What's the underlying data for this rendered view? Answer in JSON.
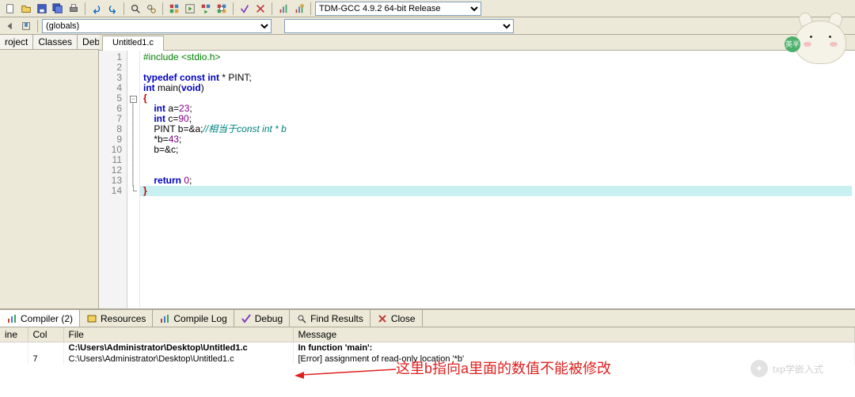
{
  "toolbar": {
    "compiler_option": "TDM-GCC 4.9.2 64-bit Release"
  },
  "toolbar2": {
    "globals_option": "(globals)"
  },
  "left_panel": {
    "tabs": [
      "roject",
      "Classes",
      "Debug"
    ]
  },
  "editor": {
    "tab_name": "Untitled1.c",
    "lines": {
      "l1": {
        "num": "1"
      },
      "l2": {
        "num": "2"
      },
      "l3": {
        "num": "3"
      },
      "l4": {
        "num": "4"
      },
      "l5": {
        "num": "5"
      },
      "l6": {
        "num": "6"
      },
      "l7": {
        "num": "7"
      },
      "l8": {
        "num": "8"
      },
      "l9": {
        "num": "9"
      },
      "l10": {
        "num": "10"
      },
      "l11": {
        "num": "11"
      },
      "l12": {
        "num": "12"
      },
      "l13": {
        "num": "13"
      },
      "l14": {
        "num": "14"
      }
    },
    "tokens": {
      "include": "#include ",
      "stdio": "<stdio.h>",
      "typedef": "typedef const int",
      "pint_decl": " * PINT;",
      "int": "int",
      "main": " main",
      "void_args": "(void)",
      "obrace": "{",
      "cbrace": "}",
      "a_decl_pre": "    ",
      "a_decl": " a=",
      "a_val": "23",
      "semi": ";",
      "c_decl": " c=",
      "c_val": "90",
      "b_decl_pre": "    PINT b=&a;",
      "b_cmt": "//相当于const int * b",
      "deref": "    *b=",
      "deref_val": "43",
      "bset": "    b=&c;",
      "ret": "return",
      "ret_rest": " 0;"
    }
  },
  "bottom": {
    "tabs": {
      "compiler": "Compiler (2)",
      "resources": "Resources",
      "compilelog": "Compile Log",
      "debug": "Debug",
      "findresults": "Find Results",
      "close": "Close"
    },
    "headers": {
      "line": "ine",
      "col": "Col",
      "file": "File",
      "message": "Message"
    },
    "rows": [
      {
        "line": "",
        "col": "",
        "file": "C:\\Users\\Administrator\\Desktop\\Untitled1.c",
        "message": "In function 'main':",
        "bold": true
      },
      {
        "line": "",
        "col": "7",
        "file": "C:\\Users\\Administrator\\Desktop\\Untitled1.c",
        "message": "[Error] assignment of read-only location '*b'",
        "bold": false
      }
    ]
  },
  "annotation": {
    "text": "这里b指向a里面的数值不能被修改"
  },
  "watermark": {
    "text": "txp学嵌入式"
  },
  "mascot": {
    "badge": "英半"
  }
}
